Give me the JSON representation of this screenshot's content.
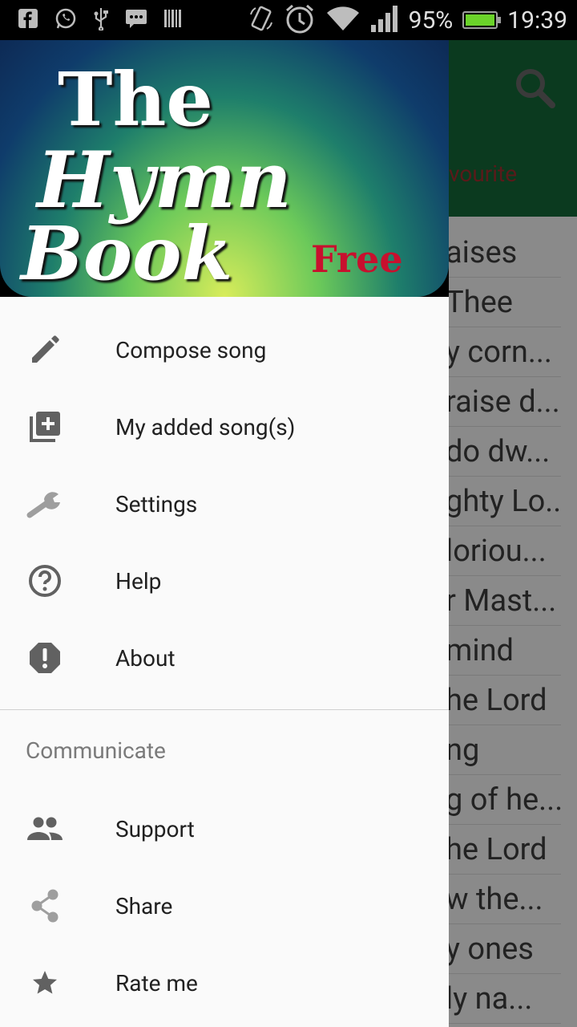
{
  "status_bar": {
    "battery": "95%",
    "time": "19:39",
    "icons": [
      "facebook-icon",
      "whatsapp-icon",
      "usb-icon",
      "message-icon",
      "barcode-icon",
      "rotate-icon",
      "alarm-icon",
      "wifi-icon",
      "signal-icon",
      "battery-icon"
    ]
  },
  "app": {
    "tab_favourite": "vourite",
    "list": [
      "aises",
      "Thee",
      "y corn...",
      "raise d...",
      "do dw...",
      "ghty Lo...",
      "loriou...",
      "r Mast...",
      "mind",
      "he Lord",
      "ng",
      "g of he...",
      "he Lord",
      "w the...",
      "y ones",
      "ly na..."
    ]
  },
  "drawer": {
    "logo": {
      "line1": "The",
      "line2": "Hymn",
      "line3": "Book",
      "badge": "Free"
    },
    "items": [
      {
        "label": "Compose song",
        "icon": "pencil-icon"
      },
      {
        "label": "My added song(s)",
        "icon": "library-add-icon"
      },
      {
        "label": "Settings",
        "icon": "wrench-icon"
      },
      {
        "label": "Help",
        "icon": "help-circle-icon"
      },
      {
        "label": "About",
        "icon": "alert-octagon-icon"
      }
    ],
    "section_title": "Communicate",
    "comm_items": [
      {
        "label": "Support",
        "icon": "people-icon"
      },
      {
        "label": "Share",
        "icon": "share-icon"
      },
      {
        "label": "Rate me",
        "icon": "star-icon"
      }
    ]
  },
  "colors": {
    "accent": "#0b3a1f",
    "icon_gray": "#616161",
    "badge_red": "#c8102e"
  }
}
